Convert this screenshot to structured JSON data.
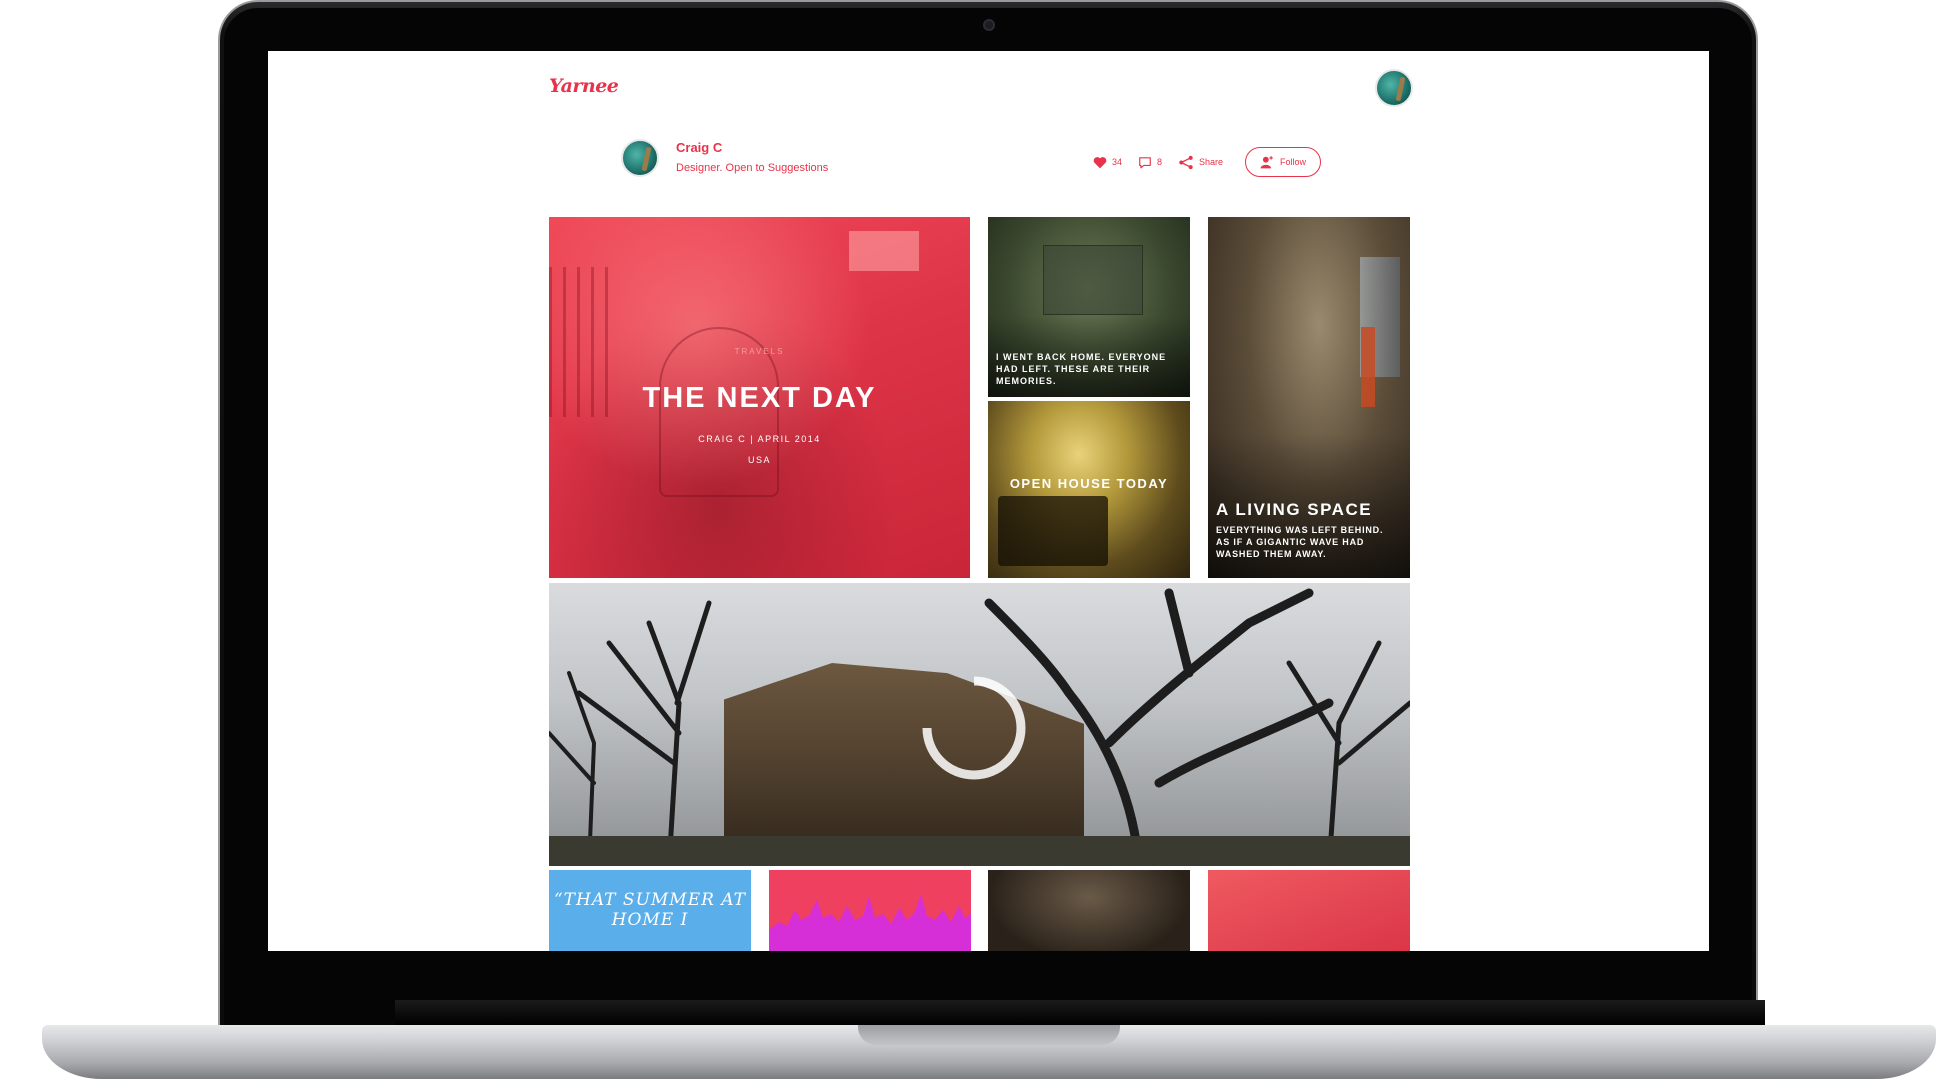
{
  "header": {
    "logo": "Yarnee"
  },
  "author": {
    "name": "Craig C",
    "bio": "Designer. Open to Suggestions"
  },
  "actions": {
    "likes": "34",
    "comments": "8",
    "share_label": "Share",
    "follow_label": "Follow"
  },
  "stories": {
    "feature": {
      "overline": "TRAVELS",
      "title": "THE NEXT DAY",
      "byline": "CRAIG C | APRIL 2014",
      "location": "USA"
    },
    "home": {
      "caption": "I WENT BACK HOME. EVERYONE HAD LEFT. THESE ARE THEIR MEMORIES."
    },
    "open_house": {
      "title": "OPEN HOUSE TODAY"
    },
    "living_space": {
      "title": "A LIVING SPACE",
      "caption": "EVERYTHING WAS LEFT BEHIND. AS IF A GIGANTIC WAVE HAD WASHED THEM AWAY."
    },
    "quote": {
      "text": "“THAT SUMMER AT HOME I"
    }
  },
  "colors": {
    "accent": "#e8334a",
    "quote_tile": "#5aaeea",
    "wave_tile": "#ef4060",
    "wave_fill": "#d62fd8"
  },
  "icons": {
    "like": "heart-icon",
    "comment": "comment-icon",
    "share": "share-icon",
    "follow": "add-user-icon",
    "loading": "loading-spinner-icon"
  }
}
